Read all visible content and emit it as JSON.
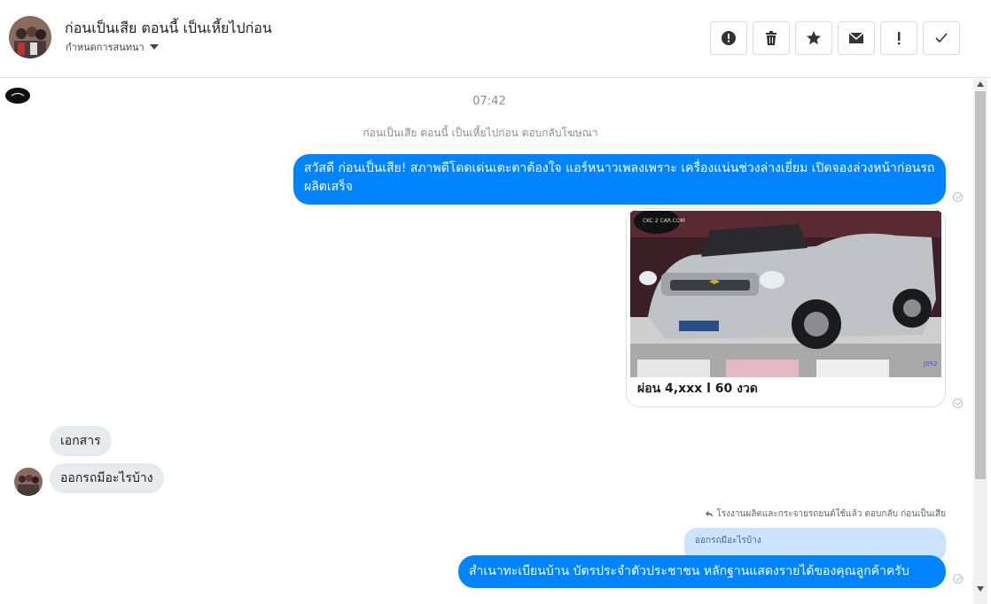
{
  "header": {
    "title": "ก่อนเป็นเสีย ตอนนี้ เป็นเหี้ยไปก่อน",
    "subtitle": "กำหนดการสนทนา",
    "actions": [
      {
        "name": "alert-circle-icon",
        "label": "Mark as spam"
      },
      {
        "name": "trash-icon",
        "label": "Delete"
      },
      {
        "name": "star-icon",
        "label": "Star"
      },
      {
        "name": "envelope-icon",
        "label": "Mark as unread"
      },
      {
        "name": "exclamation-icon",
        "label": "Mark important"
      },
      {
        "name": "check-icon",
        "label": "Done"
      }
    ]
  },
  "chat": {
    "timestamp": "07:42",
    "notice": "ก่อนเป็นเสีย ตอนนี้ เป็นเหี้ยไปก่อน ตอบกลับโฆษณา",
    "message_out_1": "สวัสดี ก่อนเป็นเสีย! สภาพดีโดดเด่นเตะตาต้องใจ แอร์หนาวเพลงเพราะ เครื่องแน่นช่วงล่างเยี่ยม เปิดจองล่วงหน้าก่อนรถผลิตเสร็จ",
    "card": {
      "watermark": "CKC 2 CAR.COM",
      "code": "J092",
      "caption": "ผ่อน 4,xxx l 60 งวด"
    },
    "message_in_1": "เอกสาร",
    "message_in_2": "ออกรถมีอะไรบ้าง",
    "reply_info": "โรงงานผลิตและกระจายรถยนต์ใช้แล้ว ตอบกลับ ก่อนเป็นเสีย",
    "quoted": "ออกรถมีอะไรบ้าง",
    "message_out_2": "สำเนาทะเบียนบ้าน บัตรประจำตัวประชาชน หลักฐานแสดงรายได้ของคุณลูกค้าครับ"
  },
  "colors": {
    "outgoing_bubble": "#0084ff",
    "incoming_bubble": "#e9eaed",
    "quoted_bubble": "#cce4ff"
  }
}
